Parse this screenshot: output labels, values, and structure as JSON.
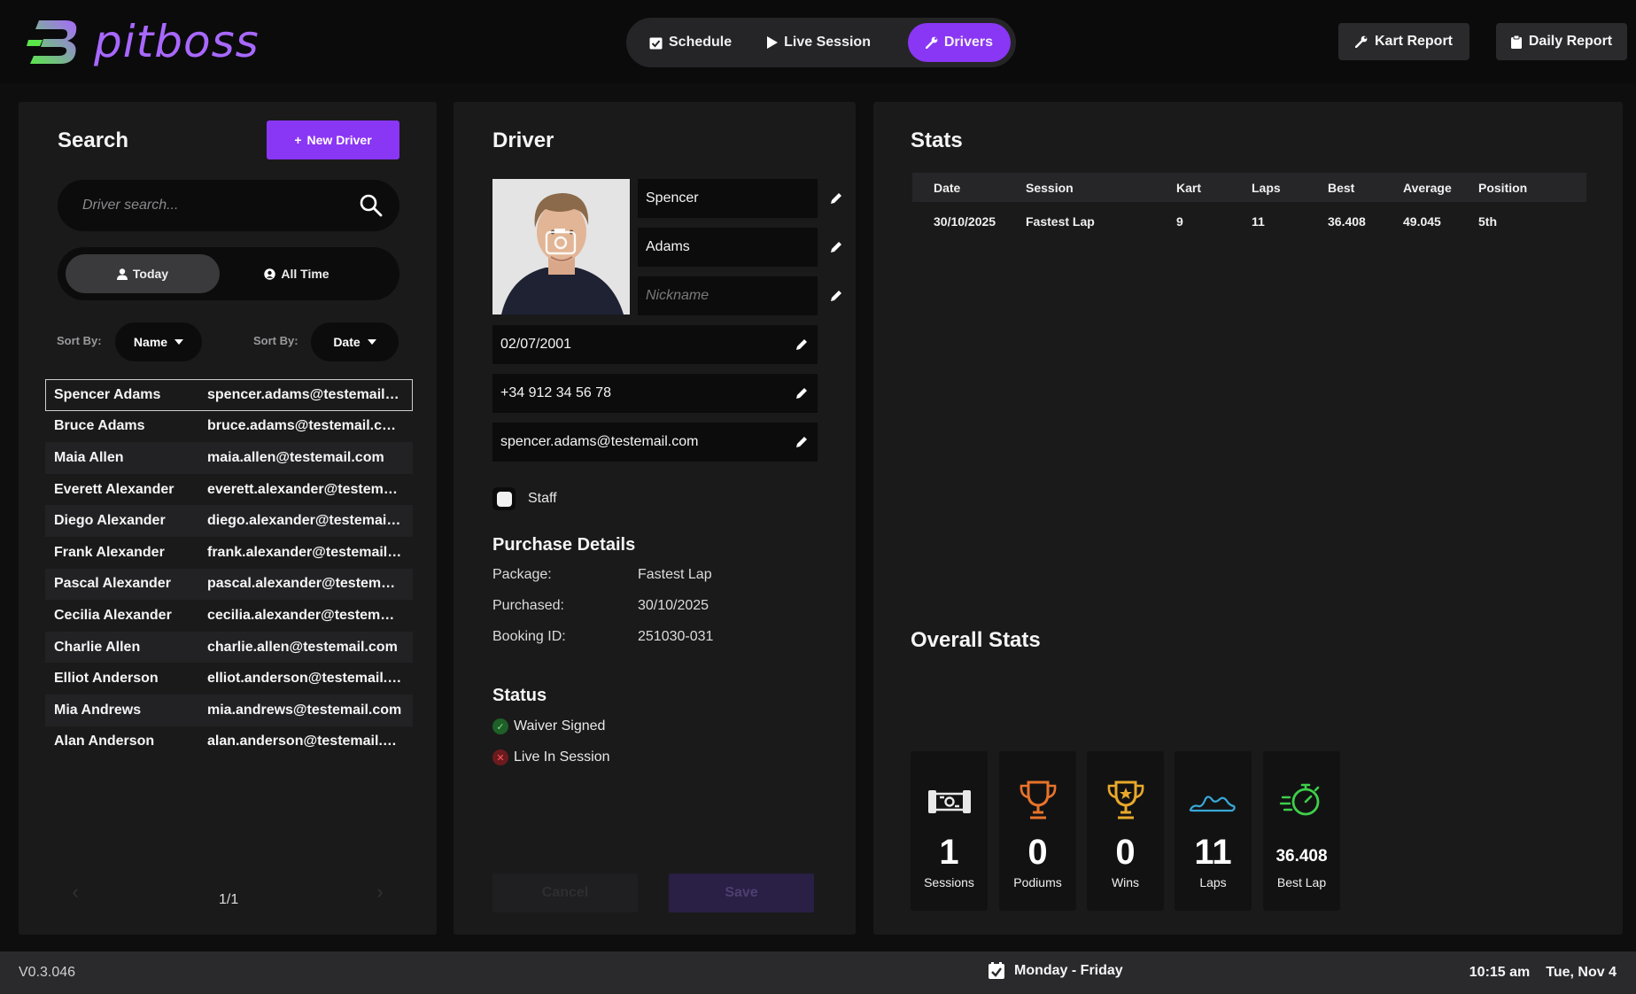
{
  "app": {
    "logo_text": "pitboss",
    "colors": {
      "accent": "#8a36f5",
      "logo_gradient_start": "#5be64a",
      "logo_gradient_end": "#a868ff",
      "background": "#0e0e0f",
      "panel": "#1a1a1b"
    }
  },
  "nav": {
    "tabs": [
      {
        "label": "Schedule",
        "icon": "calendar-check-icon",
        "active": false
      },
      {
        "label": "Live Session",
        "icon": "play-icon",
        "active": false
      },
      {
        "label": "Drivers",
        "icon": "wrench-icon",
        "active": true
      }
    ],
    "kart_report": "Kart Report",
    "daily_report": "Daily Report"
  },
  "search_panel": {
    "title": "Search",
    "new_driver_label": "New Driver",
    "search_placeholder": "Driver search...",
    "toggle": {
      "today": "Today",
      "all_time": "All Time",
      "active": "today"
    },
    "sort_by_label_1": "Sort By:",
    "sort_by_value_1": "Name",
    "sort_by_label_2": "Sort By:",
    "sort_by_value_2": "Date",
    "drivers": [
      {
        "name": "Spencer Adams",
        "email": "spencer.adams@testemail.com",
        "selected": true
      },
      {
        "name": "Bruce Adams",
        "email": "bruce.adams@testemail.com"
      },
      {
        "name": "Maia Allen",
        "email": "maia.allen@testemail.com"
      },
      {
        "name": "Everett Alexander",
        "email": "everett.alexander@testemail.com"
      },
      {
        "name": "Diego Alexander",
        "email": "diego.alexander@testemail.com"
      },
      {
        "name": "Frank Alexander",
        "email": "frank.alexander@testemail.com"
      },
      {
        "name": "Pascal Alexander",
        "email": "pascal.alexander@testemail.com"
      },
      {
        "name": "Cecilia Alexander",
        "email": "cecilia.alexander@testemail.com"
      },
      {
        "name": "Charlie Allen",
        "email": "charlie.allen@testemail.com"
      },
      {
        "name": "Elliot Anderson",
        "email": "elliot.anderson@testemail.com"
      },
      {
        "name": "Mia Andrews",
        "email": "mia.andrews@testemail.com"
      },
      {
        "name": "Alan Anderson",
        "email": "alan.anderson@testemail.com"
      }
    ],
    "pagination": "1/1"
  },
  "driver_panel": {
    "title": "Driver",
    "first_name": "Spencer",
    "last_name": "Adams",
    "nickname_placeholder": "Nickname",
    "dob": "02/07/2001",
    "phone": "+34 912 34 56 78",
    "email": "spencer.adams@testemail.com",
    "staff_label": "Staff",
    "purchase": {
      "title": "Purchase Details",
      "package_label": "Package:",
      "package_value": "Fastest Lap",
      "purchased_label": "Purchased:",
      "purchased_value": "30/10/2025",
      "booking_label": "Booking ID:",
      "booking_value": "251030-031"
    },
    "status": {
      "title": "Status",
      "waiver": "Waiver Signed",
      "live": "Live In Session",
      "waiver_color": "#2e9a3c",
      "live_color": "#b3262b"
    },
    "cancel_label": "Cancel",
    "save_label": "Save"
  },
  "stats_panel": {
    "title": "Stats",
    "columns": [
      "Date",
      "Session",
      "Kart",
      "Laps",
      "Best",
      "Average",
      "Position"
    ],
    "rows": [
      [
        "30/10/2025",
        "Fastest Lap",
        "9",
        "11",
        "36.408",
        "49.045",
        "5th"
      ]
    ],
    "overall_title": "Overall Stats",
    "cards": [
      {
        "value": "1",
        "label": "Sessions",
        "icon": "kart-icon",
        "color": "#e8e8e8"
      },
      {
        "value": "0",
        "label": "Podiums",
        "icon": "trophy-icon",
        "color": "#e8732a"
      },
      {
        "value": "0",
        "label": "Wins",
        "icon": "trophy-star-icon",
        "color": "#e8a92a"
      },
      {
        "value": "11",
        "label": "Laps",
        "icon": "track-icon",
        "color": "#3aa8d8"
      },
      {
        "value": "36.408",
        "label": "Best Lap",
        "icon": "stopwatch-icon",
        "color": "#3ecf4a"
      }
    ]
  },
  "footer": {
    "version": "V0.3.046",
    "schedule": "Monday - Friday",
    "time": "10:15 am",
    "date": "Tue, Nov 4"
  }
}
